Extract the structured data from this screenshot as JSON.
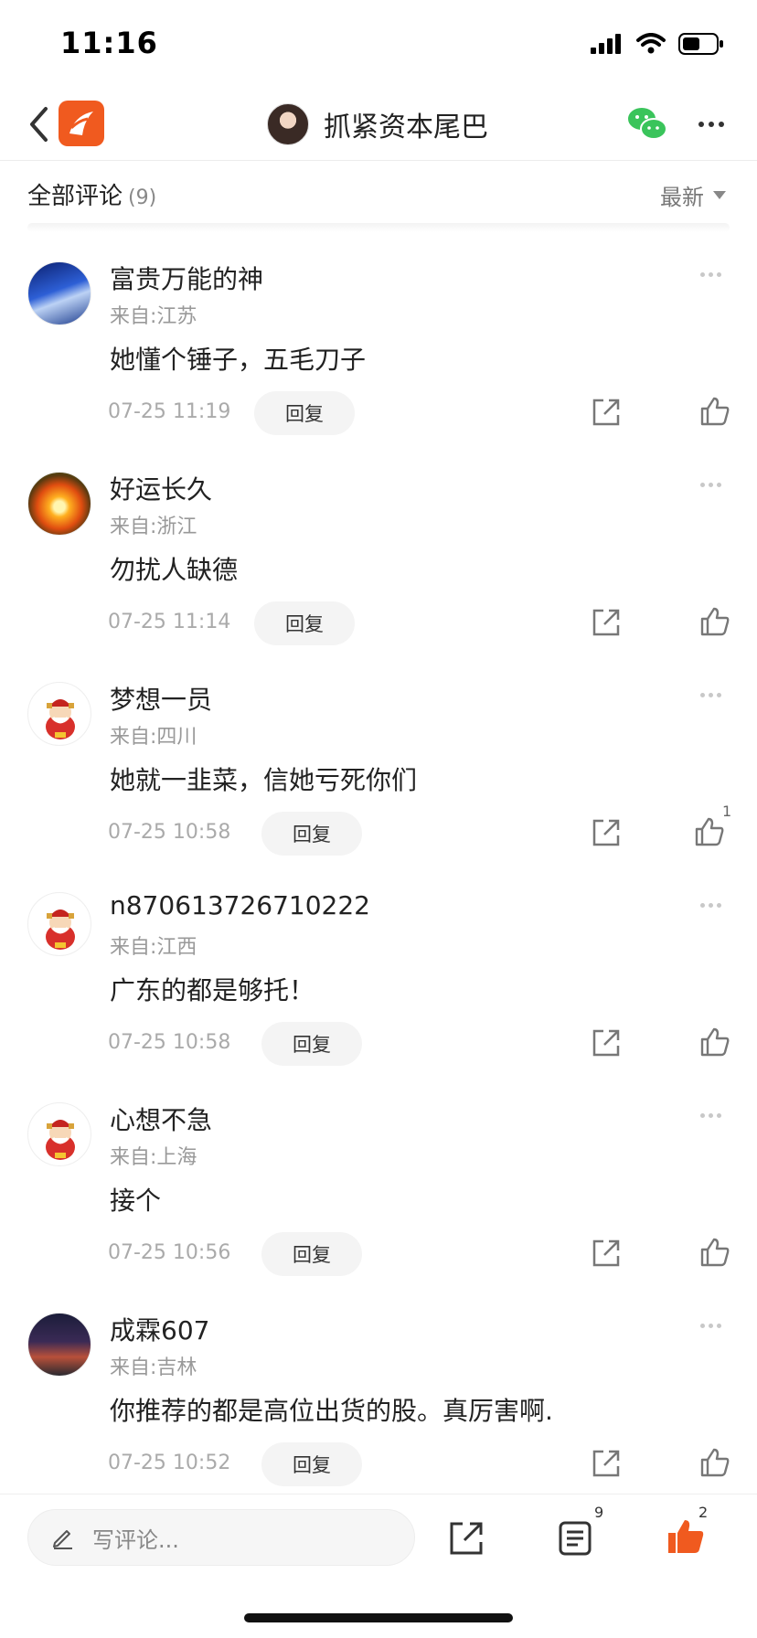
{
  "status_bar": {
    "time": "11:16"
  },
  "nav": {
    "title": "抓紧资本尾巴",
    "icons": {
      "back": "chevron-left-icon",
      "logo": "app-logo-icon",
      "share": "wechat-icon",
      "more": "more-icon"
    }
  },
  "comments_header": {
    "title": "全部评论",
    "count": "(9)",
    "sort_label": "最新"
  },
  "comments": [
    {
      "name": "富贵万能的神",
      "location": "来自:江苏",
      "text": "她懂个锤子，五毛刀子",
      "time": "07-25 11:19",
      "reply": "回复",
      "likes": ""
    },
    {
      "name": "好运长久",
      "location": "来自:浙江",
      "text": "勿扰人缺德",
      "time": "07-25 11:14",
      "reply": "回复",
      "likes": ""
    },
    {
      "name": "梦想一员",
      "location": "来自:四川",
      "text": "她就一韭菜，信她亏死你们",
      "time": "07-25 10:58",
      "reply": "回复",
      "likes": "1"
    },
    {
      "name": "n870613726710222",
      "location": "来自:江西",
      "text": "广东的都是够托！",
      "time": "07-25 10:58",
      "reply": "回复",
      "likes": ""
    },
    {
      "name": "心想不急",
      "location": "来自:上海",
      "text": "接个",
      "time": "07-25 10:56",
      "reply": "回复",
      "likes": ""
    },
    {
      "name": "成霖607",
      "location": "来自:吉林",
      "text": "你推荐的都是高位出货的股。真厉害啊.",
      "time": "07-25 10:52",
      "reply": "回复",
      "likes": ""
    }
  ],
  "bottom_bar": {
    "input_placeholder": "写评论...",
    "comment_count": "9",
    "like_count": "2"
  },
  "colors": {
    "accent": "#f05a1f",
    "wechat": "#3ac45b"
  }
}
